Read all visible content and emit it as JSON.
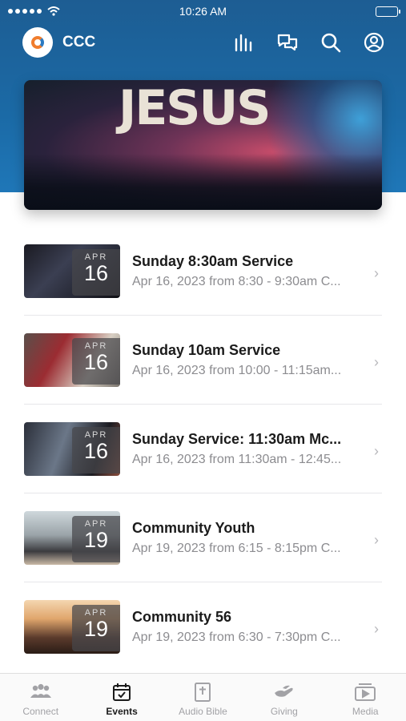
{
  "status_bar": {
    "time": "10:26 AM"
  },
  "app": {
    "title": "CCC"
  },
  "hero": {
    "text": "JESUS"
  },
  "events": [
    {
      "month": "APR",
      "day": "16",
      "title": "Sunday 8:30am Service",
      "subtitle": "Apr 16, 2023 from 8:30 - 9:30am C..."
    },
    {
      "month": "APR",
      "day": "16",
      "title": "Sunday 10am Service",
      "subtitle": "Apr 16, 2023 from 10:00 - 11:15am..."
    },
    {
      "month": "APR",
      "day": "16",
      "title": "Sunday Service: 11:30am Mc...",
      "subtitle": "Apr 16, 2023 from 11:30am - 12:45..."
    },
    {
      "month": "APR",
      "day": "19",
      "title": "Community Youth",
      "subtitle": "Apr 19, 2023 from 6:15 - 8:15pm C..."
    },
    {
      "month": "APR",
      "day": "19",
      "title": "Community 56",
      "subtitle": "Apr 19, 2023 from 6:30 - 7:30pm C..."
    }
  ],
  "tabs": [
    {
      "label": "Connect",
      "icon": "people-icon",
      "active": false
    },
    {
      "label": "Events",
      "icon": "calendar-icon",
      "active": true
    },
    {
      "label": "Audio Bible",
      "icon": "bible-icon",
      "active": false
    },
    {
      "label": "Giving",
      "icon": "giving-hand-icon",
      "active": false
    },
    {
      "label": "Media",
      "icon": "media-play-icon",
      "active": false
    }
  ],
  "colors": {
    "header": "#1d5d93",
    "accent": "#f07d2d",
    "tab_inactive": "#a2a2a6"
  }
}
